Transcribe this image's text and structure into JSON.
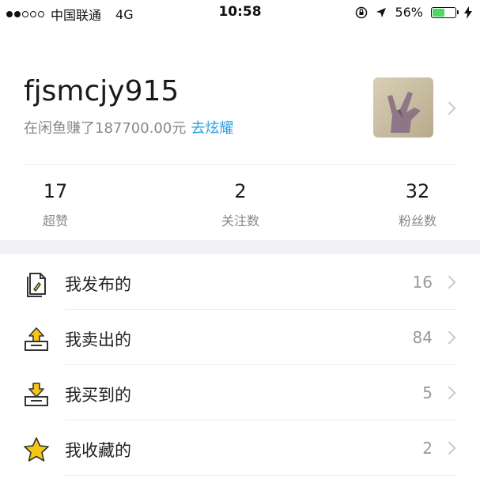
{
  "status_bar": {
    "carrier": "中国联通",
    "network": "4G",
    "time": "10:58",
    "battery_percent": "56%",
    "battery_level": 0.56,
    "signal_bars": 2,
    "signal_total": 5
  },
  "profile": {
    "username": "fjsmcjy915",
    "earnings_text": "在闲鱼赚了187700.00元",
    "show_off_link": "去炫耀"
  },
  "stats": [
    {
      "value": "17",
      "label": "超赞"
    },
    {
      "value": "2",
      "label": "关注数"
    },
    {
      "value": "32",
      "label": "粉丝数"
    }
  ],
  "menu": [
    {
      "label": "我发布的",
      "count": "16",
      "icon": "published-document-icon"
    },
    {
      "label": "我卖出的",
      "count": "84",
      "icon": "sold-box-upload-icon"
    },
    {
      "label": "我买到的",
      "count": "5",
      "icon": "bought-box-download-icon"
    },
    {
      "label": "我收藏的",
      "count": "2",
      "icon": "star-icon"
    }
  ],
  "colors": {
    "accent_link": "#2aa0e0",
    "icon_yellow": "#f5c518",
    "battery_green": "#4cd964"
  }
}
